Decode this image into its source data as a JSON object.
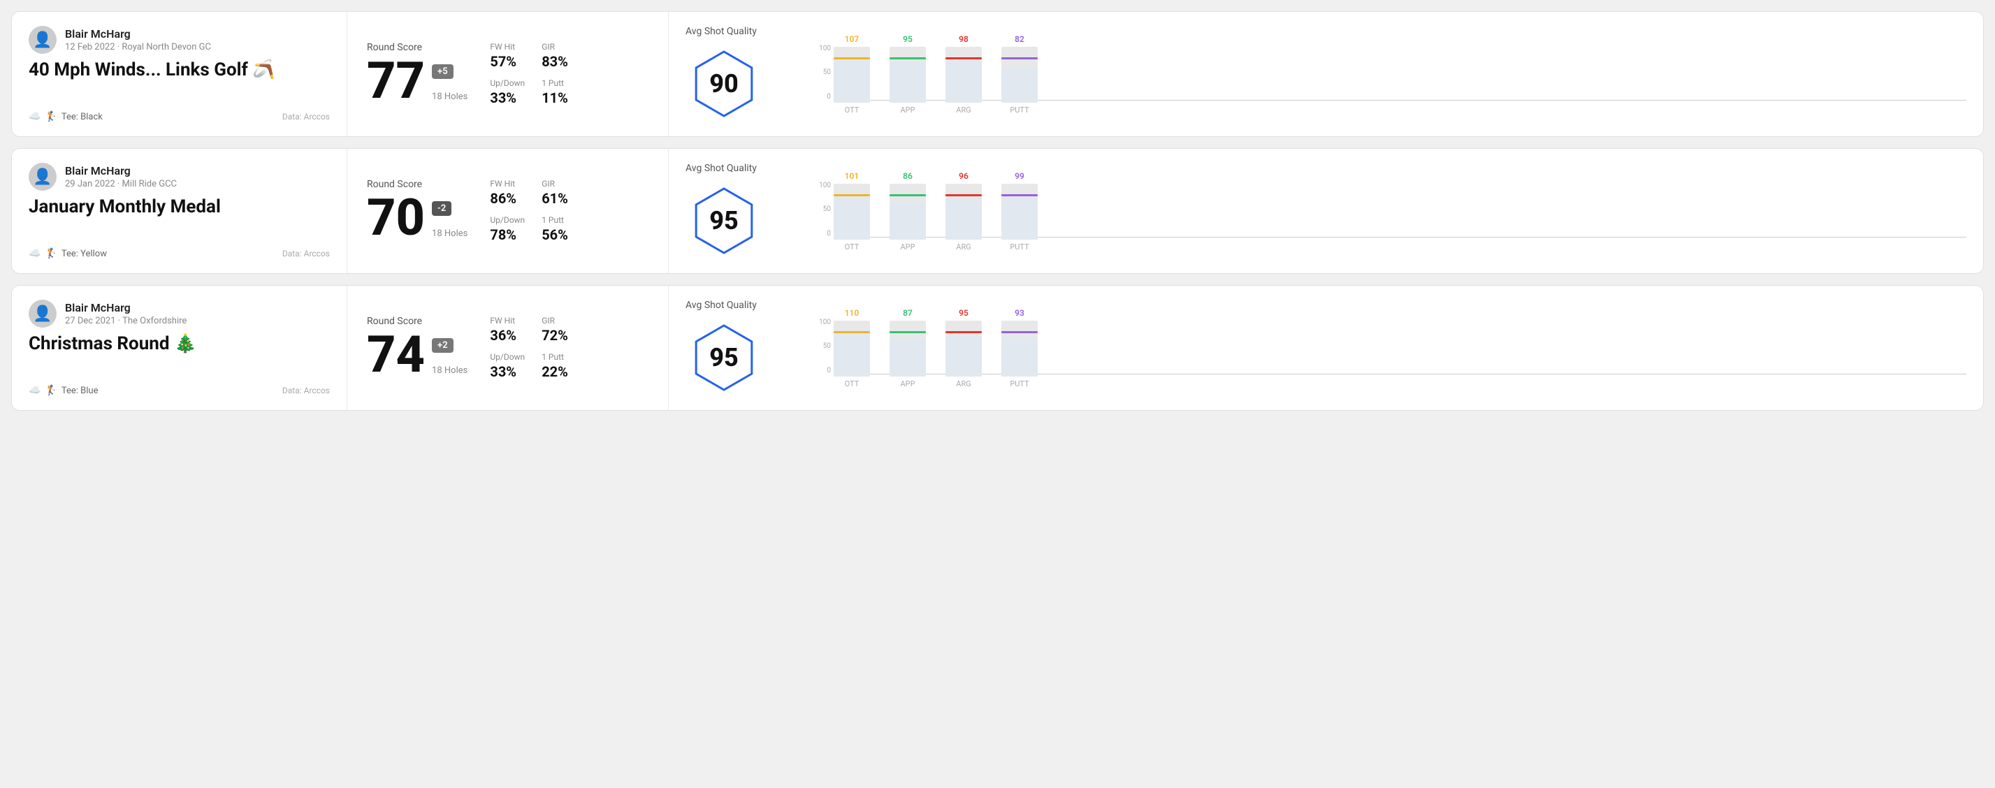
{
  "rounds": [
    {
      "id": "round-1",
      "user": {
        "name": "Blair McHarg",
        "date": "12 Feb 2022 · Royal North Devon GC"
      },
      "title": "40 Mph Winds... Links Golf 🪃",
      "tee": "Black",
      "data_source": "Data: Arccos",
      "score": {
        "label": "Round Score",
        "value": "77",
        "badge": "+5",
        "badge_type": "positive",
        "holes": "18 Holes"
      },
      "stats": {
        "fw_hit_label": "FW Hit",
        "fw_hit_value": "57%",
        "gir_label": "GIR",
        "gir_value": "83%",
        "updown_label": "Up/Down",
        "updown_value": "33%",
        "putt_label": "1 Putt",
        "putt_value": "11%"
      },
      "quality": {
        "label": "Avg Shot Quality",
        "score": "90"
      },
      "chart": {
        "bars": [
          {
            "label": "OTT",
            "value": 107,
            "color": "#f0b429",
            "bar_pct": 75
          },
          {
            "label": "APP",
            "value": 95,
            "color": "#38c172",
            "bar_pct": 65
          },
          {
            "label": "ARG",
            "value": 98,
            "color": "#e3342f",
            "bar_pct": 68
          },
          {
            "label": "PUTT",
            "value": 82,
            "color": "#9561e2",
            "bar_pct": 56
          }
        ],
        "y_labels": [
          "100",
          "50",
          "0"
        ]
      }
    },
    {
      "id": "round-2",
      "user": {
        "name": "Blair McHarg",
        "date": "29 Jan 2022 · Mill Ride GCC"
      },
      "title": "January Monthly Medal",
      "tee": "Yellow",
      "data_source": "Data: Arccos",
      "score": {
        "label": "Round Score",
        "value": "70",
        "badge": "-2",
        "badge_type": "negative",
        "holes": "18 Holes"
      },
      "stats": {
        "fw_hit_label": "FW Hit",
        "fw_hit_value": "86%",
        "gir_label": "GIR",
        "gir_value": "61%",
        "updown_label": "Up/Down",
        "updown_value": "78%",
        "putt_label": "1 Putt",
        "putt_value": "56%"
      },
      "quality": {
        "label": "Avg Shot Quality",
        "score": "95"
      },
      "chart": {
        "bars": [
          {
            "label": "OTT",
            "value": 101,
            "color": "#f0b429",
            "bar_pct": 72
          },
          {
            "label": "APP",
            "value": 86,
            "color": "#38c172",
            "bar_pct": 58
          },
          {
            "label": "ARG",
            "value": 96,
            "color": "#e3342f",
            "bar_pct": 67
          },
          {
            "label": "PUTT",
            "value": 99,
            "color": "#9561e2",
            "bar_pct": 70
          }
        ],
        "y_labels": [
          "100",
          "50",
          "0"
        ]
      }
    },
    {
      "id": "round-3",
      "user": {
        "name": "Blair McHarg",
        "date": "27 Dec 2021 · The Oxfordshire"
      },
      "title": "Christmas Round 🎄",
      "tee": "Blue",
      "data_source": "Data: Arccos",
      "score": {
        "label": "Round Score",
        "value": "74",
        "badge": "+2",
        "badge_type": "positive",
        "holes": "18 Holes"
      },
      "stats": {
        "fw_hit_label": "FW Hit",
        "fw_hit_value": "36%",
        "gir_label": "GIR",
        "gir_value": "72%",
        "updown_label": "Up/Down",
        "updown_value": "33%",
        "putt_label": "1 Putt",
        "putt_value": "22%"
      },
      "quality": {
        "label": "Avg Shot Quality",
        "score": "95"
      },
      "chart": {
        "bars": [
          {
            "label": "OTT",
            "value": 110,
            "color": "#f0b429",
            "bar_pct": 78
          },
          {
            "label": "APP",
            "value": 87,
            "color": "#38c172",
            "bar_pct": 59
          },
          {
            "label": "ARG",
            "value": 95,
            "color": "#e3342f",
            "bar_pct": 66
          },
          {
            "label": "PUTT",
            "value": 93,
            "color": "#9561e2",
            "bar_pct": 65
          }
        ],
        "y_labels": [
          "100",
          "50",
          "0"
        ]
      }
    }
  ]
}
